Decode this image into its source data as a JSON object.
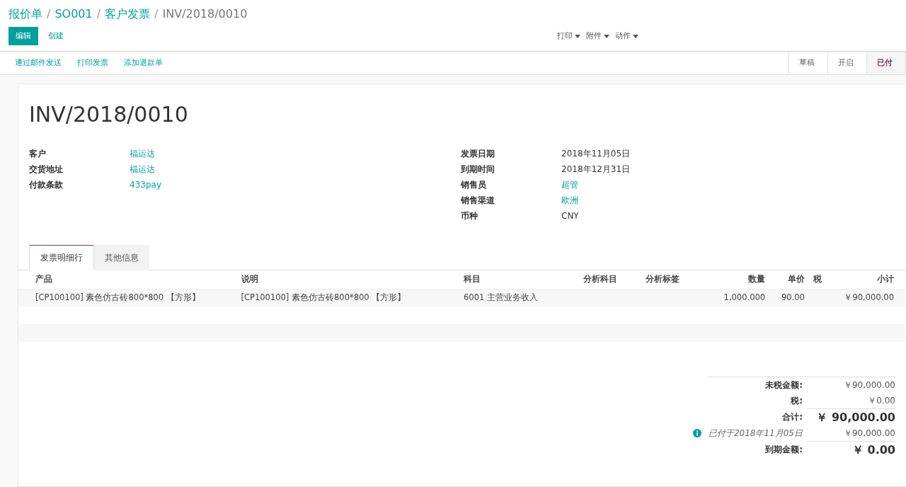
{
  "breadcrumb_separator": "/",
  "breadcrumbs": [
    {
      "label": "报价单",
      "kind": "link"
    },
    {
      "label": "SO001",
      "kind": "link"
    },
    {
      "label": "客户发票",
      "kind": "link"
    },
    {
      "label": "INV/2018/0010",
      "kind": "current"
    }
  ],
  "buttons": [
    {
      "label": "编辑",
      "kind": "primary"
    },
    {
      "label": "创建",
      "kind": "secondary"
    }
  ],
  "menus": [
    "打印",
    "附件",
    "动作"
  ],
  "actions": [
    "通过邮件发送",
    "打印发票",
    "添加退款单"
  ],
  "stages": [
    {
      "label": "草稿",
      "selected": false
    },
    {
      "label": "开启",
      "selected": false
    },
    {
      "label": "已付",
      "selected": true
    }
  ],
  "title": "INV/2018/0010",
  "fields_left": [
    {
      "label": "客户",
      "value": "福运达",
      "kind": "link"
    },
    {
      "label": "交货地址",
      "value": "福运达",
      "kind": "link"
    },
    {
      "label": "付款条款",
      "value": "433pay",
      "kind": "link"
    }
  ],
  "fields_right": [
    {
      "label": "发票日期",
      "value": "2018年11月05日",
      "kind": "text"
    },
    {
      "label": "到期时间",
      "value": "2018年12月31日",
      "kind": "text"
    },
    {
      "label": "销售员",
      "value": "超管",
      "kind": "link"
    },
    {
      "label": "销售渠道",
      "value": "欧洲",
      "kind": "link"
    },
    {
      "label": "币种",
      "value": "CNY",
      "kind": "text"
    }
  ],
  "tabs": [
    {
      "label": "发票明细行",
      "selected": true
    },
    {
      "label": "其他信息",
      "selected": false
    }
  ],
  "table": {
    "columns": [
      "产品",
      "说明",
      "科目",
      "分析科目",
      "分析标签",
      "数量",
      "单价",
      "税",
      "小计"
    ],
    "rows": [
      [
        "[CP100100] 素色仿古砖800*800 【方形】",
        "[CP100100] 素色仿古砖800*800 【方形】",
        "6001 主营业务收入",
        "",
        "",
        "1,000.000",
        "90.00",
        "",
        "￥90,000.00"
      ]
    ]
  },
  "totals": [
    {
      "label": "未税金额:",
      "value": "￥90,000.00",
      "kind": "normal"
    },
    {
      "label": "税:",
      "value": "￥0.00",
      "kind": "normal"
    },
    {
      "label": "合计:",
      "value": "￥ 90,000.00",
      "kind": "grand"
    },
    {
      "label": "已付于2018年11月05日",
      "value": "￥90,000.00",
      "kind": "payment"
    },
    {
      "label": "到期金额:",
      "value": "￥ 0.00",
      "kind": "grand"
    }
  ]
}
